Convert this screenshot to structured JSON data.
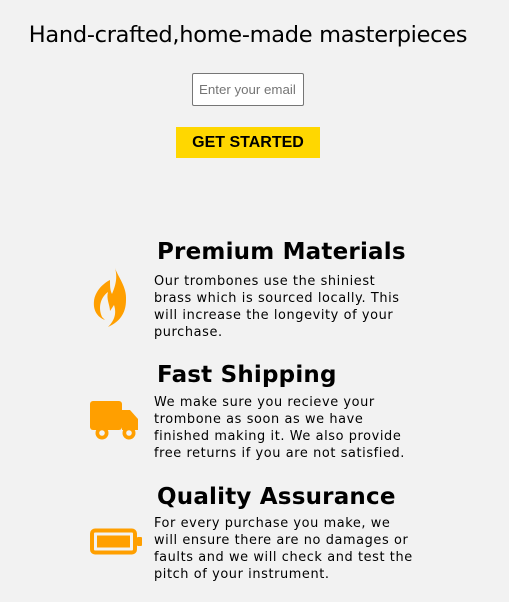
{
  "hero": {
    "title": "Hand-crafted,home-made masterpieces",
    "email_placeholder": "Enter your email",
    "cta_label": "GET STARTED"
  },
  "colors": {
    "background": "#f2f2f2",
    "accent": "#ffd700",
    "icon": "#ff9f00"
  },
  "features": [
    {
      "icon": "fire-icon",
      "title": "Premium Materials",
      "description": "Our trombones use the shiniest brass which is sourced locally. This will increase the longevity of your purchase."
    },
    {
      "icon": "truck-icon",
      "title": "Fast Shipping",
      "description": "We make sure you recieve your trombone as soon as we have finished making it. We also provide free returns if you are not satisfied."
    },
    {
      "icon": "battery-full-icon",
      "title": "Quality Assurance",
      "description": "For every purchase you make, we will ensure there are no damages or faults and we will check and test the pitch of your instrument."
    }
  ]
}
